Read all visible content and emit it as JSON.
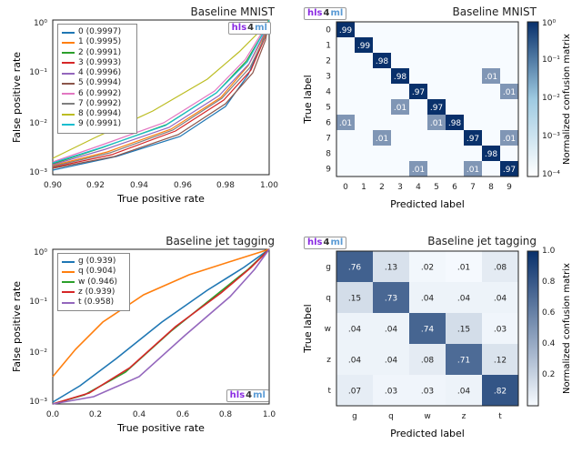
{
  "watermark": {
    "hls": "hls",
    "four": "4",
    "ml": "ml"
  },
  "roc_mnist": {
    "title": "Baseline MNIST",
    "xlabel": "True positive rate",
    "ylabel": "False positive rate",
    "xrange": [
      0.9,
      1.0
    ],
    "xticks": [
      "0.90",
      "0.92",
      "0.94",
      "0.96",
      "0.98",
      "1.00"
    ],
    "yticks": [
      "10⁻³",
      "10⁻²",
      "10⁻¹",
      "10⁰"
    ],
    "legend": [
      {
        "name": "0",
        "val": "(0.9997)",
        "color": "#1f77b4"
      },
      {
        "name": "1",
        "val": "(0.9995)",
        "color": "#ff7f0e"
      },
      {
        "name": "2",
        "val": "(0.9991)",
        "color": "#2ca02c"
      },
      {
        "name": "3",
        "val": "(0.9993)",
        "color": "#d62728"
      },
      {
        "name": "4",
        "val": "(0.9996)",
        "color": "#9467bd"
      },
      {
        "name": "5",
        "val": "(0.9994)",
        "color": "#8c564b"
      },
      {
        "name": "6",
        "val": "(0.9992)",
        "color": "#e377c2"
      },
      {
        "name": "7",
        "val": "(0.9992)",
        "color": "#7f7f7f"
      },
      {
        "name": "8",
        "val": "(0.9994)",
        "color": "#bcbd22"
      },
      {
        "name": "9",
        "val": "(0.9991)",
        "color": "#17becf"
      }
    ]
  },
  "roc_jet": {
    "title": "Baseline jet tagging",
    "xlabel": "True positive rate",
    "ylabel": "False positive rate",
    "xrange": [
      0.0,
      1.0
    ],
    "xticks": [
      "0.0",
      "0.2",
      "0.4",
      "0.6",
      "0.8",
      "1.0"
    ],
    "yticks": [
      "10⁻³",
      "10⁻²",
      "10⁻¹",
      "10⁰"
    ],
    "legend": [
      {
        "name": "g",
        "val": "(0.939)",
        "color": "#1f77b4"
      },
      {
        "name": "q",
        "val": "(0.904)",
        "color": "#ff7f0e"
      },
      {
        "name": "w",
        "val": "(0.946)",
        "color": "#2ca02c"
      },
      {
        "name": "z",
        "val": "(0.939)",
        "color": "#d62728"
      },
      {
        "name": "t",
        "val": "(0.958)",
        "color": "#9467bd"
      }
    ]
  },
  "cm_mnist": {
    "title": "Baseline MNIST",
    "xlabel": "Predicted label",
    "ylabel": "True label",
    "cbar_label": "Normalized confusion matrix",
    "cbar_ticks": [
      "10⁻⁴",
      "10⁻³",
      "10⁻²",
      "10⁻¹",
      "10⁰"
    ],
    "labels": [
      "0",
      "1",
      "2",
      "3",
      "4",
      "5",
      "6",
      "7",
      "8",
      "9"
    ],
    "matrix": [
      [
        0.99,
        0,
        0,
        0,
        0,
        0,
        0,
        0,
        0,
        0
      ],
      [
        0,
        0.99,
        0,
        0,
        0,
        0,
        0,
        0,
        0,
        0
      ],
      [
        0,
        0,
        0.98,
        0,
        0,
        0,
        0,
        0,
        0,
        0
      ],
      [
        0,
        0,
        0,
        0.98,
        0,
        0,
        0,
        0,
        0.01,
        0
      ],
      [
        0,
        0,
        0,
        0,
        0.97,
        0,
        0,
        0,
        0,
        0.01
      ],
      [
        0,
        0,
        0,
        0.01,
        0,
        0.97,
        0,
        0,
        0,
        0
      ],
      [
        0.01,
        0,
        0,
        0,
        0,
        0.01,
        0.98,
        0,
        0,
        0
      ],
      [
        0,
        0,
        0.01,
        0,
        0,
        0,
        0,
        0.97,
        0,
        0.01
      ],
      [
        0,
        0,
        0,
        0,
        0,
        0,
        0,
        0,
        0.98,
        0
      ],
      [
        0,
        0,
        0,
        0,
        0.01,
        0,
        0,
        0.01,
        0,
        0.97
      ]
    ]
  },
  "cm_jet": {
    "title": "Baseline jet tagging",
    "xlabel": "Predicted label",
    "ylabel": "True label",
    "cbar_label": "Normalized confusion matrix",
    "cbar_ticks": [
      "0.2",
      "0.4",
      "0.6",
      "0.8",
      "1.0"
    ],
    "labels": [
      "g",
      "q",
      "w",
      "z",
      "t"
    ],
    "matrix": [
      [
        0.76,
        0.13,
        0.02,
        0.01,
        0.08
      ],
      [
        0.15,
        0.73,
        0.04,
        0.04,
        0.04
      ],
      [
        0.04,
        0.04,
        0.74,
        0.15,
        0.03
      ],
      [
        0.04,
        0.04,
        0.08,
        0.71,
        0.12
      ],
      [
        0.07,
        0.03,
        0.03,
        0.04,
        0.82
      ]
    ]
  },
  "chart_data": [
    {
      "type": "line",
      "name": "ROC Baseline MNIST",
      "title": "Baseline MNIST",
      "xlabel": "True positive rate",
      "ylabel": "False positive rate",
      "xlim": [
        0.9,
        1.0
      ],
      "ylim": [
        0.001,
        1.0
      ],
      "yscale": "log",
      "series": [
        {
          "name": "0",
          "auc": 0.9997
        },
        {
          "name": "1",
          "auc": 0.9995
        },
        {
          "name": "2",
          "auc": 0.9991
        },
        {
          "name": "3",
          "auc": 0.9993
        },
        {
          "name": "4",
          "auc": 0.9996
        },
        {
          "name": "5",
          "auc": 0.9994
        },
        {
          "name": "6",
          "auc": 0.9992
        },
        {
          "name": "7",
          "auc": 0.9992
        },
        {
          "name": "8",
          "auc": 0.9994
        },
        {
          "name": "9",
          "auc": 0.9991
        }
      ]
    },
    {
      "type": "line",
      "name": "ROC Baseline jet tagging",
      "title": "Baseline jet tagging",
      "xlabel": "True positive rate",
      "ylabel": "False positive rate",
      "xlim": [
        0.0,
        1.0
      ],
      "ylim": [
        0.001,
        1.0
      ],
      "yscale": "log",
      "series": [
        {
          "name": "g",
          "auc": 0.939
        },
        {
          "name": "q",
          "auc": 0.904
        },
        {
          "name": "w",
          "auc": 0.946
        },
        {
          "name": "z",
          "auc": 0.939
        },
        {
          "name": "t",
          "auc": 0.958
        }
      ]
    },
    {
      "type": "heatmap",
      "name": "Confusion matrix Baseline MNIST",
      "title": "Baseline MNIST",
      "xlabel": "Predicted label",
      "ylabel": "True label",
      "colorbar": "Normalized confusion matrix",
      "x": [
        "0",
        "1",
        "2",
        "3",
        "4",
        "5",
        "6",
        "7",
        "8",
        "9"
      ],
      "y": [
        "0",
        "1",
        "2",
        "3",
        "4",
        "5",
        "6",
        "7",
        "8",
        "9"
      ],
      "values": [
        [
          0.99,
          null,
          null,
          null,
          null,
          null,
          null,
          null,
          null,
          null
        ],
        [
          null,
          0.99,
          null,
          null,
          null,
          null,
          null,
          null,
          null,
          null
        ],
        [
          null,
          null,
          0.98,
          null,
          null,
          null,
          null,
          null,
          null,
          null
        ],
        [
          null,
          null,
          null,
          0.98,
          null,
          null,
          null,
          null,
          0.01,
          null
        ],
        [
          null,
          null,
          null,
          null,
          0.97,
          null,
          null,
          null,
          null,
          0.01
        ],
        [
          null,
          null,
          null,
          0.01,
          null,
          0.97,
          null,
          null,
          null,
          null
        ],
        [
          0.01,
          null,
          null,
          null,
          null,
          0.01,
          0.98,
          null,
          null,
          null
        ],
        [
          null,
          null,
          0.01,
          null,
          null,
          null,
          null,
          0.97,
          null,
          0.01
        ],
        [
          null,
          null,
          null,
          null,
          null,
          null,
          null,
          null,
          0.98,
          null
        ],
        [
          null,
          null,
          null,
          null,
          0.01,
          null,
          null,
          0.01,
          null,
          0.97
        ]
      ]
    },
    {
      "type": "heatmap",
      "name": "Confusion matrix Baseline jet tagging",
      "title": "Baseline jet tagging",
      "xlabel": "Predicted label",
      "ylabel": "True label",
      "colorbar": "Normalized confusion matrix",
      "x": [
        "g",
        "q",
        "w",
        "z",
        "t"
      ],
      "y": [
        "g",
        "q",
        "w",
        "z",
        "t"
      ],
      "values": [
        [
          0.76,
          0.13,
          0.02,
          0.01,
          0.08
        ],
        [
          0.15,
          0.73,
          0.04,
          0.04,
          0.04
        ],
        [
          0.04,
          0.04,
          0.74,
          0.15,
          0.03
        ],
        [
          0.04,
          0.04,
          0.08,
          0.71,
          0.12
        ],
        [
          0.07,
          0.03,
          0.03,
          0.04,
          0.82
        ]
      ]
    }
  ]
}
